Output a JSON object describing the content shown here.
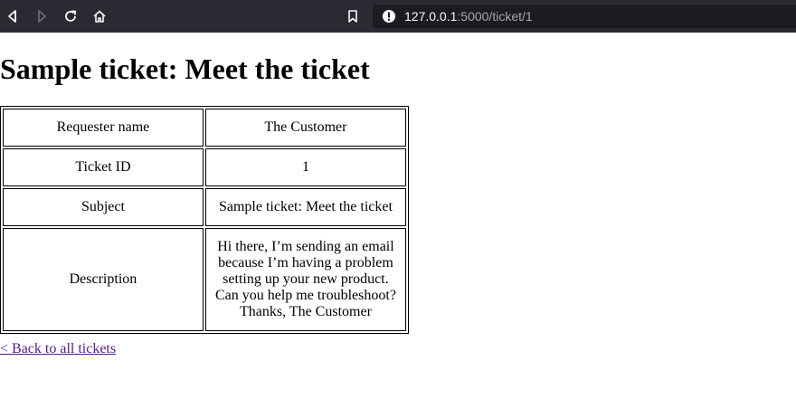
{
  "browser": {
    "url_host": "127.0.0.1",
    "url_rest": ":5000/ticket/1",
    "icons": {
      "back": "back-arrow-icon",
      "forward": "forward-arrow-icon",
      "reload": "reload-icon",
      "home": "home-icon",
      "bookmark": "bookmark-icon",
      "info": "info-icon"
    }
  },
  "page": {
    "title": "Sample ticket: Meet the ticket",
    "back_link": "< Back to all tickets"
  },
  "ticket": {
    "rows": [
      {
        "label": "Requester name",
        "value": "The Customer"
      },
      {
        "label": "Ticket ID",
        "value": "1"
      },
      {
        "label": "Subject",
        "value": "Sample ticket: Meet the ticket"
      },
      {
        "label": "Description",
        "value": "Hi there, I’m sending an email because I’m having a problem setting up your new product. Can you help me troubleshoot? Thanks, The Customer"
      }
    ]
  },
  "colors": {
    "toolbar_bg": "#2b2a33",
    "urlbar_bg": "#1c1b22",
    "visited_link": "#551a8b"
  }
}
